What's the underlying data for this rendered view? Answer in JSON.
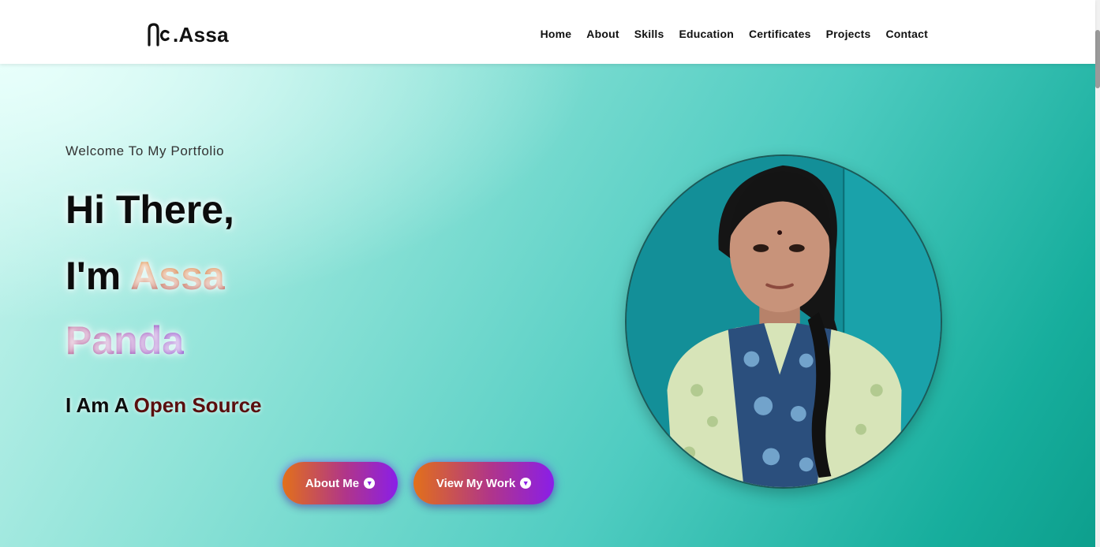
{
  "navbar": {
    "logo_text": ".Assa",
    "links": [
      "Home",
      "About",
      "Skills",
      "Education",
      "Certificates",
      "Projects",
      "Contact"
    ]
  },
  "hero": {
    "welcome": "Welcome To My Portfolio",
    "line1": "Hi There,",
    "line2_prefix": "I'm ",
    "line2_name": "Assa",
    "line3": "Panda",
    "typed_prefix": "I Am A ",
    "typed_role": "Open Source",
    "buttons": {
      "about": "About Me",
      "work": "View My Work"
    }
  },
  "colors": {
    "accent_orange": "#e07a12",
    "accent_purple": "#8a1ee8",
    "teal": "#17ae9d"
  },
  "icons": {
    "button_icon": "chevron-down-circle-icon",
    "logo": "logo-mark-icon"
  }
}
